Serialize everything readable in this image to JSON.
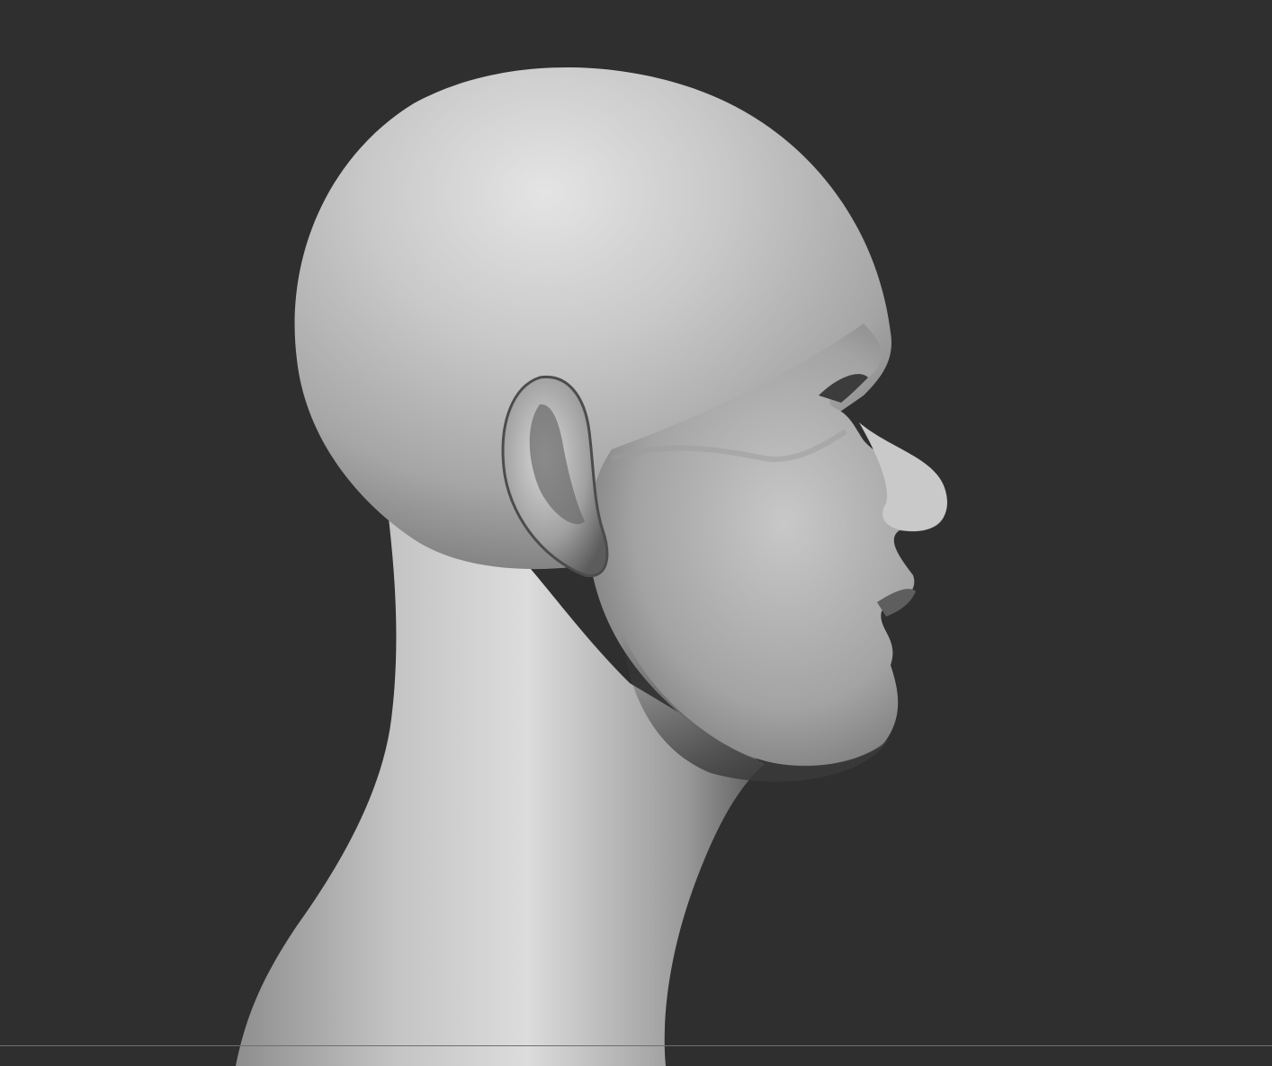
{
  "viewport": {
    "background_color": "#2f2f2f",
    "model": {
      "subject": "head-and-neck",
      "view": "profile-right",
      "material_color": "#b9b9b9",
      "highlight_color": "#e6e6e6",
      "shadow_color": "#3a3a3a"
    },
    "ground_line_color": "#6e6e6e"
  }
}
